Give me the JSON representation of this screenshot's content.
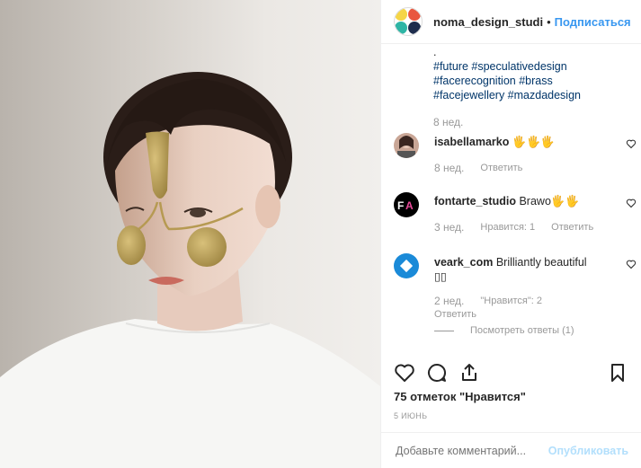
{
  "header": {
    "username": "noma_design_studi",
    "dot": "•",
    "follow": "Подписаться"
  },
  "caption": {
    "period": ".",
    "hashtags_line1": "#future #speculativedesign",
    "hashtags_line2": "#facerecognition #brass",
    "hashtags_line3": "#facejewellery #mazdadesign",
    "time": "8 нед."
  },
  "comments": [
    {
      "user": "isabellamarko",
      "text": "🖐🖐🖐",
      "time": "8 нед.",
      "reply": "Ответить"
    },
    {
      "user": "fontarte_studio",
      "text": "Brawo🖐🖐",
      "time": "3 нед.",
      "likes": "Нравится: 1",
      "reply": "Ответить"
    },
    {
      "user": "veark_com",
      "text": "Brilliantly beautiful",
      "text2": "▯▯",
      "time": "2 нед.",
      "likes": "\"Нравится\": 2",
      "reply": "Ответить",
      "view_replies": "Посмотреть ответы (1)"
    }
  ],
  "likes": "75 отметок \"Нравится\"",
  "date": "5 июнь",
  "comment_box": {
    "placeholder": "Добавьте комментарий...",
    "publish": "Опубликовать"
  },
  "colors": {
    "link_blue": "#3897f0",
    "hashtag": "#003569",
    "muted": "#999999"
  }
}
